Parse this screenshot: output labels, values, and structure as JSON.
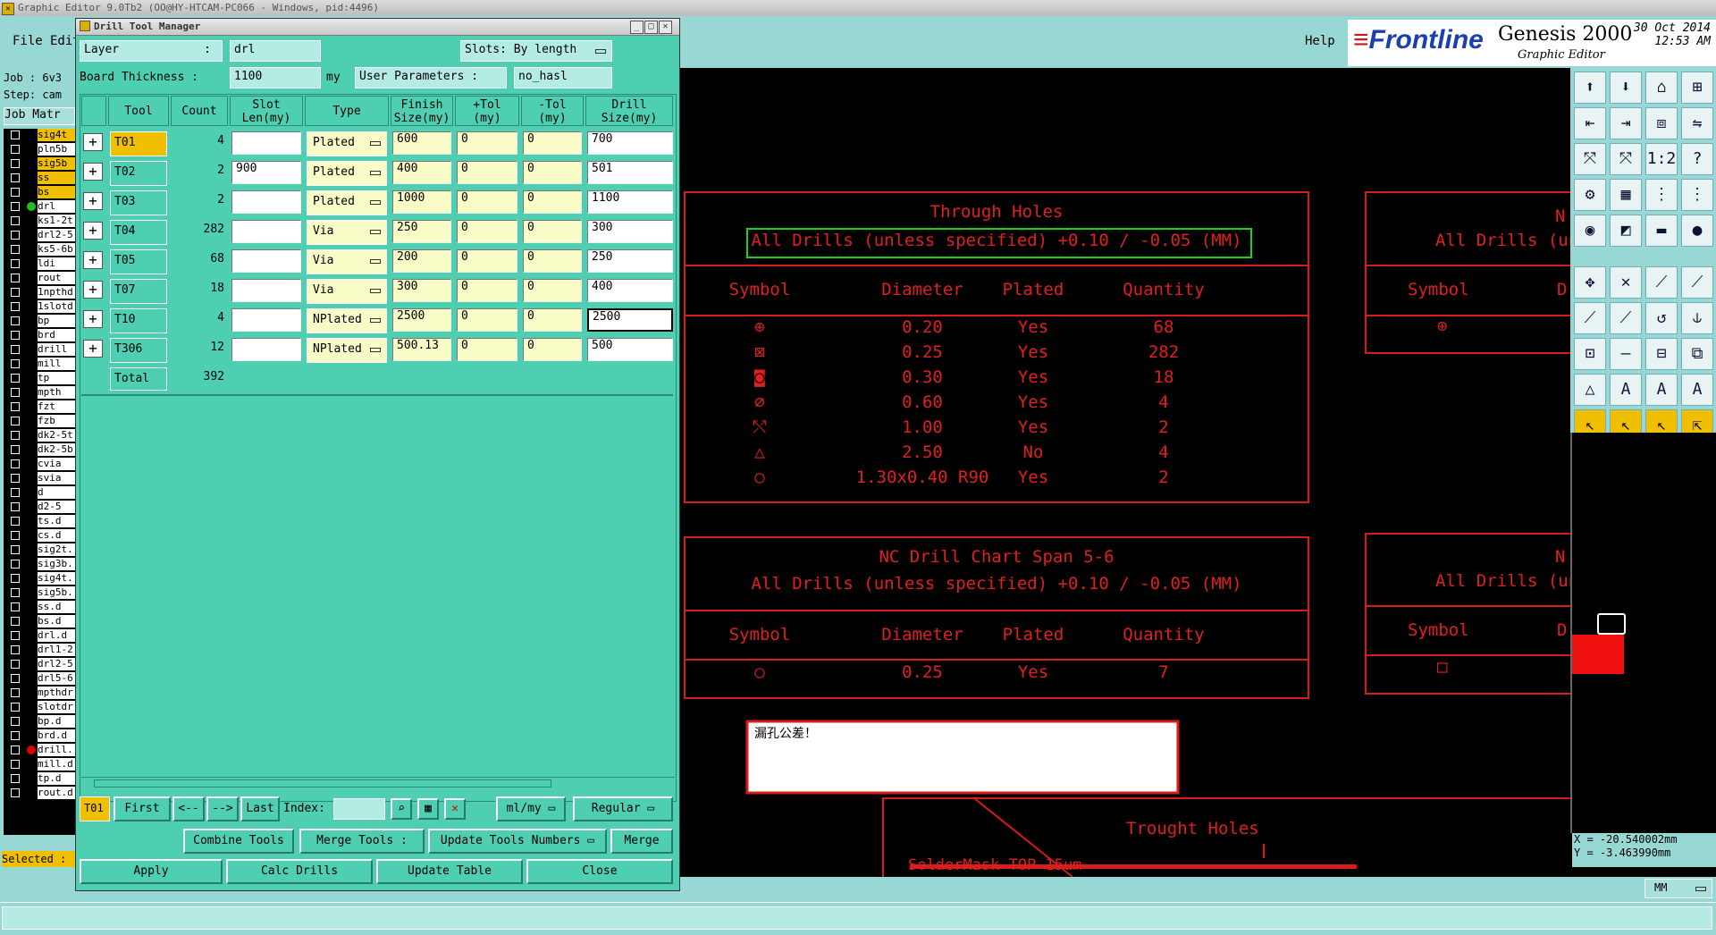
{
  "window": {
    "title": "Graphic Editor 9.0Tb2 (OO@HY-HTCAM-PC066 - Windows, pid:4496)"
  },
  "menu": {
    "file": "File",
    "edit": "Edit",
    "help": "Help"
  },
  "brand": {
    "logo": "Frontline",
    "product": "Genesis 2000",
    "subtitle": "Graphic Editor",
    "date": "30 Oct 2014",
    "time": "12:53 AM"
  },
  "job_panel": {
    "job": "Job : 6v3",
    "step": "Step: cam",
    "matrix": "Job Matr",
    "selected": "Selected :",
    "layers": [
      {
        "name": "sig4t",
        "color": "#f0c000"
      },
      {
        "name": "pln5b",
        "color": "#ffffff"
      },
      {
        "name": "sig5b",
        "color": "#f0c000"
      },
      {
        "name": "ss",
        "color": "#f0c000"
      },
      {
        "name": "bs",
        "color": "#f0c000"
      },
      {
        "name": "drl",
        "color": "#ffffff",
        "dot": "#20c020"
      },
      {
        "name": "ks1-2t",
        "color": "#ffffff"
      },
      {
        "name": "drl2-5",
        "color": "#ffffff"
      },
      {
        "name": "ks5-6b",
        "color": "#ffffff"
      },
      {
        "name": "ldi",
        "color": "#ffffff"
      },
      {
        "name": "rout",
        "color": "#ffffff"
      },
      {
        "name": "1npthd",
        "color": "#ffffff"
      },
      {
        "name": "1slotd",
        "color": "#ffffff"
      },
      {
        "name": "bp",
        "color": "#ffffff"
      },
      {
        "name": "brd",
        "color": "#ffffff"
      },
      {
        "name": "drill",
        "color": "#ffffff"
      },
      {
        "name": "mill",
        "color": "#ffffff"
      },
      {
        "name": "tp",
        "color": "#ffffff"
      },
      {
        "name": "mpth",
        "color": "#ffffff"
      },
      {
        "name": "fzt",
        "color": "#ffffff"
      },
      {
        "name": "fzb",
        "color": "#ffffff"
      },
      {
        "name": "dk2-5t",
        "color": "#ffffff"
      },
      {
        "name": "dk2-5b",
        "color": "#ffffff"
      },
      {
        "name": "cvia",
        "color": "#ffffff"
      },
      {
        "name": "svia",
        "color": "#ffffff"
      },
      {
        "name": "d",
        "color": "#ffffff"
      },
      {
        "name": "d2-5",
        "color": "#ffffff"
      },
      {
        "name": "ts.d",
        "color": "#ffffff"
      },
      {
        "name": "cs.d",
        "color": "#ffffff"
      },
      {
        "name": "sig2t.",
        "color": "#ffffff"
      },
      {
        "name": "sig3b.",
        "color": "#ffffff"
      },
      {
        "name": "sig4t.",
        "color": "#ffffff"
      },
      {
        "name": "sig5b.",
        "color": "#ffffff"
      },
      {
        "name": "ss.d",
        "color": "#ffffff"
      },
      {
        "name": "bs.d",
        "color": "#ffffff"
      },
      {
        "name": "drl.d",
        "color": "#ffffff"
      },
      {
        "name": "drl1-2",
        "color": "#ffffff"
      },
      {
        "name": "drl2-5",
        "color": "#ffffff"
      },
      {
        "name": "drl5-6",
        "color": "#ffffff"
      },
      {
        "name": "mpthdr",
        "color": "#ffffff"
      },
      {
        "name": "slotdr",
        "color": "#ffffff"
      },
      {
        "name": "bp.d",
        "color": "#ffffff"
      },
      {
        "name": "brd.d",
        "color": "#ffffff"
      },
      {
        "name": "drill.",
        "color": "#ffffff",
        "dot": "#e00000"
      },
      {
        "name": "mill.d",
        "color": "#ffffff"
      },
      {
        "name": "tp.d",
        "color": "#ffffff"
      },
      {
        "name": "rout.d",
        "color": "#ffffff"
      }
    ]
  },
  "dialog": {
    "title": "Drill Tool Manager",
    "layer_label": "Layer",
    "layer_colon": ":",
    "layer_value": "drl",
    "slots_label": "Slots:",
    "slots_value": "By length",
    "board_label": "Board Thickness :",
    "board_value": "1100",
    "board_unit": "my",
    "user_params_label": "User Parameters :",
    "user_params_value": "no_hasl",
    "headers": [
      "Tool",
      "Count",
      "Slot Len(my)",
      "Type",
      "Finish Size(my)",
      "+Tol (my)",
      "-Tol (my)",
      "Drill Size(my)"
    ],
    "rows": [
      {
        "tool": "T01",
        "count": "4",
        "slot": "",
        "type": "Plated",
        "finish": "600",
        "ptol": "0",
        "mtol": "0",
        "drill": "700"
      },
      {
        "tool": "T02",
        "count": "2",
        "slot": "900",
        "type": "Plated",
        "finish": "400",
        "ptol": "0",
        "mtol": "0",
        "drill": "501"
      },
      {
        "tool": "T03",
        "count": "2",
        "slot": "",
        "type": "Plated",
        "finish": "1000",
        "ptol": "0",
        "mtol": "0",
        "drill": "1100"
      },
      {
        "tool": "T04",
        "count": "282",
        "slot": "",
        "type": "Via",
        "finish": "250",
        "ptol": "0",
        "mtol": "0",
        "drill": "300"
      },
      {
        "tool": "T05",
        "count": "68",
        "slot": "",
        "type": "Via",
        "finish": "200",
        "ptol": "0",
        "mtol": "0",
        "drill": "250"
      },
      {
        "tool": "T07",
        "count": "18",
        "slot": "",
        "type": "Via",
        "finish": "300",
        "ptol": "0",
        "mtol": "0",
        "drill": "400"
      },
      {
        "tool": "T10",
        "count": "4",
        "slot": "",
        "type": "NPlated",
        "finish": "2500",
        "ptol": "0",
        "mtol": "0",
        "drill": "2500"
      },
      {
        "tool": "T306",
        "count": "12",
        "slot": "",
        "type": "NPlated",
        "finish": "500.13",
        "ptol": "0",
        "mtol": "0",
        "drill": "500"
      }
    ],
    "total_label": "Total",
    "total_value": "392",
    "nav": {
      "current": "T01",
      "first": "First",
      "prev": "<--",
      "next": "-->",
      "last": "Last",
      "index_label": "Index:",
      "units": "ml/my",
      "mode": "Regular"
    },
    "actions": {
      "combine": "Combine Tools",
      "merge_label": "Merge Tools :",
      "update_numbers": "Update Tools Numbers",
      "merge": "Merge",
      "apply": "Apply",
      "calc": "Calc Drills",
      "update_table": "Update Table",
      "close": "Close"
    }
  },
  "canvas": {
    "chart1": {
      "title": "Through Holes",
      "subtitle": "All Drills (unless specified) +0.10 / -0.05 (MM)",
      "cols": [
        "Symbol",
        "Diameter",
        "Plated",
        "Quantity"
      ],
      "rows": [
        {
          "sym": "⊕",
          "dia": "0.20",
          "plated": "Yes",
          "qty": "68"
        },
        {
          "sym": "⊠",
          "dia": "0.25",
          "plated": "Yes",
          "qty": "282"
        },
        {
          "sym": "◙",
          "dia": "0.30",
          "plated": "Yes",
          "qty": "18"
        },
        {
          "sym": "∅",
          "dia": "0.60",
          "plated": "Yes",
          "qty": "4"
        },
        {
          "sym": "⤲",
          "dia": "1.00",
          "plated": "Yes",
          "qty": "2"
        },
        {
          "sym": "△",
          "dia": "2.50",
          "plated": "No",
          "qty": "4"
        },
        {
          "sym": "○",
          "dia": "1.30x0.40 R90",
          "plated": "Yes",
          "qty": "2"
        }
      ]
    },
    "chart2": {
      "title": "NC Drill Chart Span 5-6",
      "subtitle": "All Drills (unless specified) +0.10 / -0.05 (MM)",
      "cols": [
        "Symbol",
        "Diameter",
        "Plated",
        "Quantity"
      ],
      "rows": [
        {
          "sym": "○",
          "dia": "0.25",
          "plated": "Yes",
          "qty": "7"
        }
      ]
    },
    "chart3": {
      "title_frag": "N",
      "subtitle_frag": "All Drills (un",
      "col_sym": "Symbol",
      "col_d": "D",
      "sym": "⊕"
    },
    "chart4": {
      "title_frag": "N",
      "subtitle_frag": "All Drills (un",
      "col_sym": "Symbol",
      "col_d": "D",
      "sym": "□"
    },
    "note": "漏孔公差！",
    "chart5": {
      "title": "Trought Holes",
      "sub": "SolderMask TOP 15um"
    }
  },
  "coords": {
    "x": "X = -20.540002mm",
    "y": "Y =  -3.463990mm"
  },
  "units_box": "MM"
}
